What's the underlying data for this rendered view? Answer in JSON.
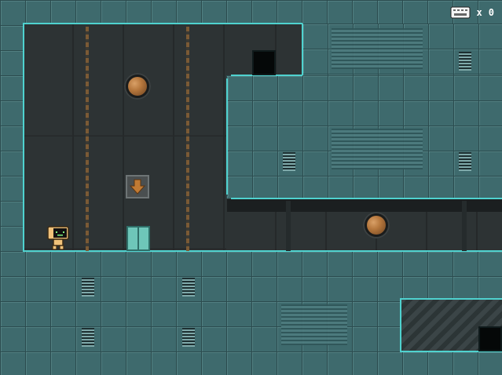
{
  "hud": {
    "counter_prefix": "x",
    "counter_value": "0",
    "icon": "keyboard-icon"
  },
  "colors": {
    "tile": "#3e6a6d",
    "edge": "#4fd2cf",
    "interior": "#2d3334",
    "orb": "#b5773d"
  },
  "icons": [
    "bronze-orb-icon",
    "down-arrow-icon",
    "robot-player-icon",
    "keyboard-icon"
  ]
}
